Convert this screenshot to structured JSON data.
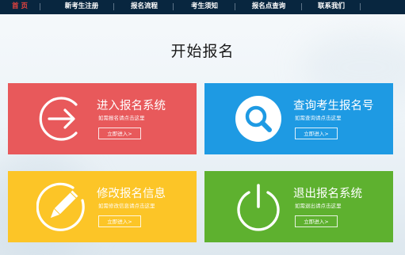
{
  "nav": {
    "items": [
      "首 页",
      "新考生注册",
      "报名流程",
      "考生须知",
      "报名点查询",
      "联系我们"
    ],
    "active_index": 0,
    "active_color": "#e8433f",
    "bg_color": "#08263f"
  },
  "page": {
    "title": "开始报名"
  },
  "cards": [
    {
      "title": "进入报名系统",
      "desc": "如需报名请点击这里",
      "button": "立即进入>",
      "icon": "arrow-right-circle-icon",
      "color": "#e8595b"
    },
    {
      "title": "查询考生报名号",
      "desc": "如需查询请点击这里",
      "button": "立即进入>",
      "icon": "search-icon",
      "color": "#1e9ae3"
    },
    {
      "title": "修改报名信息",
      "desc": "如需修改信息请点击这里",
      "button": "立即进入>",
      "icon": "pencil-circle-icon",
      "color": "#fcc527"
    },
    {
      "title": "退出报名系统",
      "desc": "如需退出请点击这里",
      "button": "立即进入>",
      "icon": "power-icon",
      "color": "#5eb12f"
    }
  ]
}
